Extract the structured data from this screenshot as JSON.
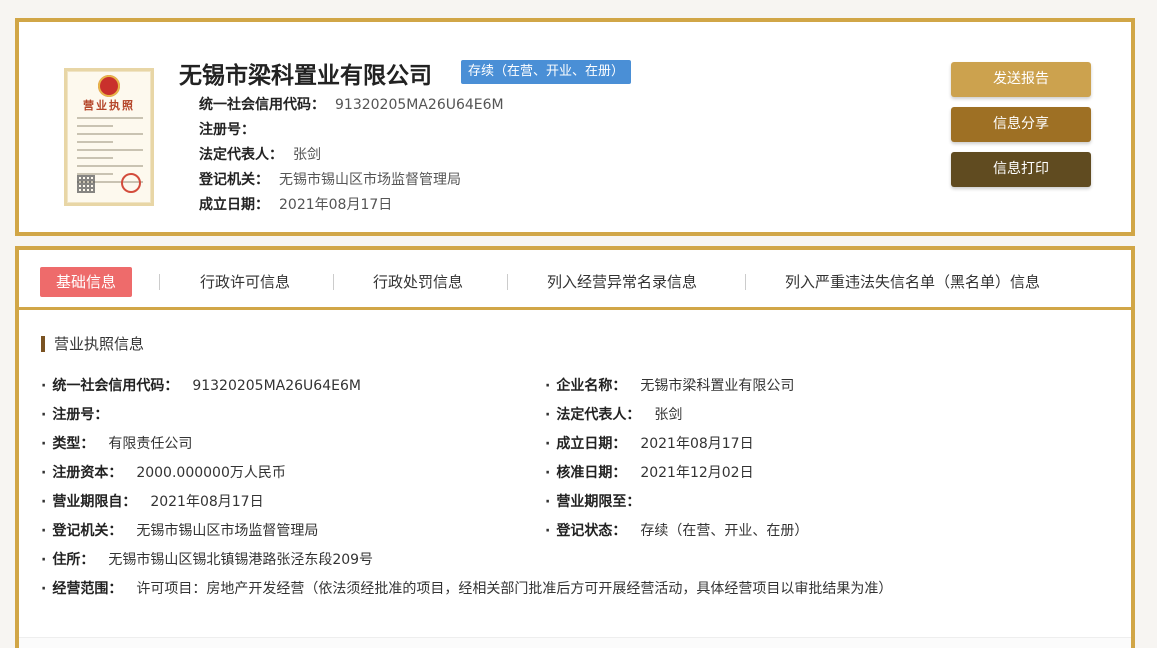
{
  "header": {
    "company_name": "无锡市梁科置业有限公司",
    "status": "存续（在营、开业、在册）",
    "fields": [
      {
        "label": "统一社会信用代码：",
        "value": "91320205MA26U64E6M"
      },
      {
        "label": "注册号：",
        "value": ""
      },
      {
        "label": "法定代表人：",
        "value": "张剑"
      },
      {
        "label": "登记机关：",
        "value": "无锡市锡山区市场监督管理局"
      },
      {
        "label": "成立日期：",
        "value": "2021年08月17日"
      }
    ],
    "buttons": {
      "send": "发送报告",
      "share": "信息分享",
      "print": "信息打印"
    },
    "license_image_title": "营业执照"
  },
  "tabs": [
    {
      "label": "基础信息",
      "active": true
    },
    {
      "label": "行政许可信息",
      "active": false
    },
    {
      "label": "行政处罚信息",
      "active": false
    },
    {
      "label": "列入经营异常名录信息",
      "active": false
    },
    {
      "label": "列入严重违法失信名单（黑名单）信息",
      "active": false
    }
  ],
  "section": {
    "title": "营业执照信息",
    "left_fields": [
      {
        "label": "统一社会信用代码：",
        "value": "91320205MA26U64E6M"
      },
      {
        "label": "注册号：",
        "value": ""
      },
      {
        "label": "类型：",
        "value": "有限责任公司"
      },
      {
        "label": "注册资本：",
        "value": "2000.000000万人民币"
      },
      {
        "label": "营业期限自：",
        "value": "2021年08月17日"
      },
      {
        "label": "登记机关：",
        "value": "无锡市锡山区市场监督管理局"
      },
      {
        "label": "住所：",
        "value": "无锡市锡山区锡北镇锡港路张泾东段209号"
      },
      {
        "label": "经营范围：",
        "value": "许可项目：房地产开发经营（依法须经批准的项目，经相关部门批准后方可开展经营活动，具体经营项目以审批结果为准）"
      }
    ],
    "right_fields": [
      {
        "label": "企业名称：",
        "value": "无锡市梁科置业有限公司"
      },
      {
        "label": "法定代表人：",
        "value": "张剑"
      },
      {
        "label": "成立日期：",
        "value": "2021年08月17日"
      },
      {
        "label": "核准日期：",
        "value": "2021年12月02日"
      },
      {
        "label": "营业期限至：",
        "value": ""
      },
      {
        "label": "登记状态：",
        "value": "存续（在营、开业、在册）"
      }
    ]
  },
  "colors": {
    "gold_border": "#d1a647",
    "btn_send": "#cca24e",
    "btn_share": "#9e7024",
    "btn_print": "#604b20",
    "status_badge": "#4a8fd6",
    "active_tab": "#ee6b6b"
  }
}
